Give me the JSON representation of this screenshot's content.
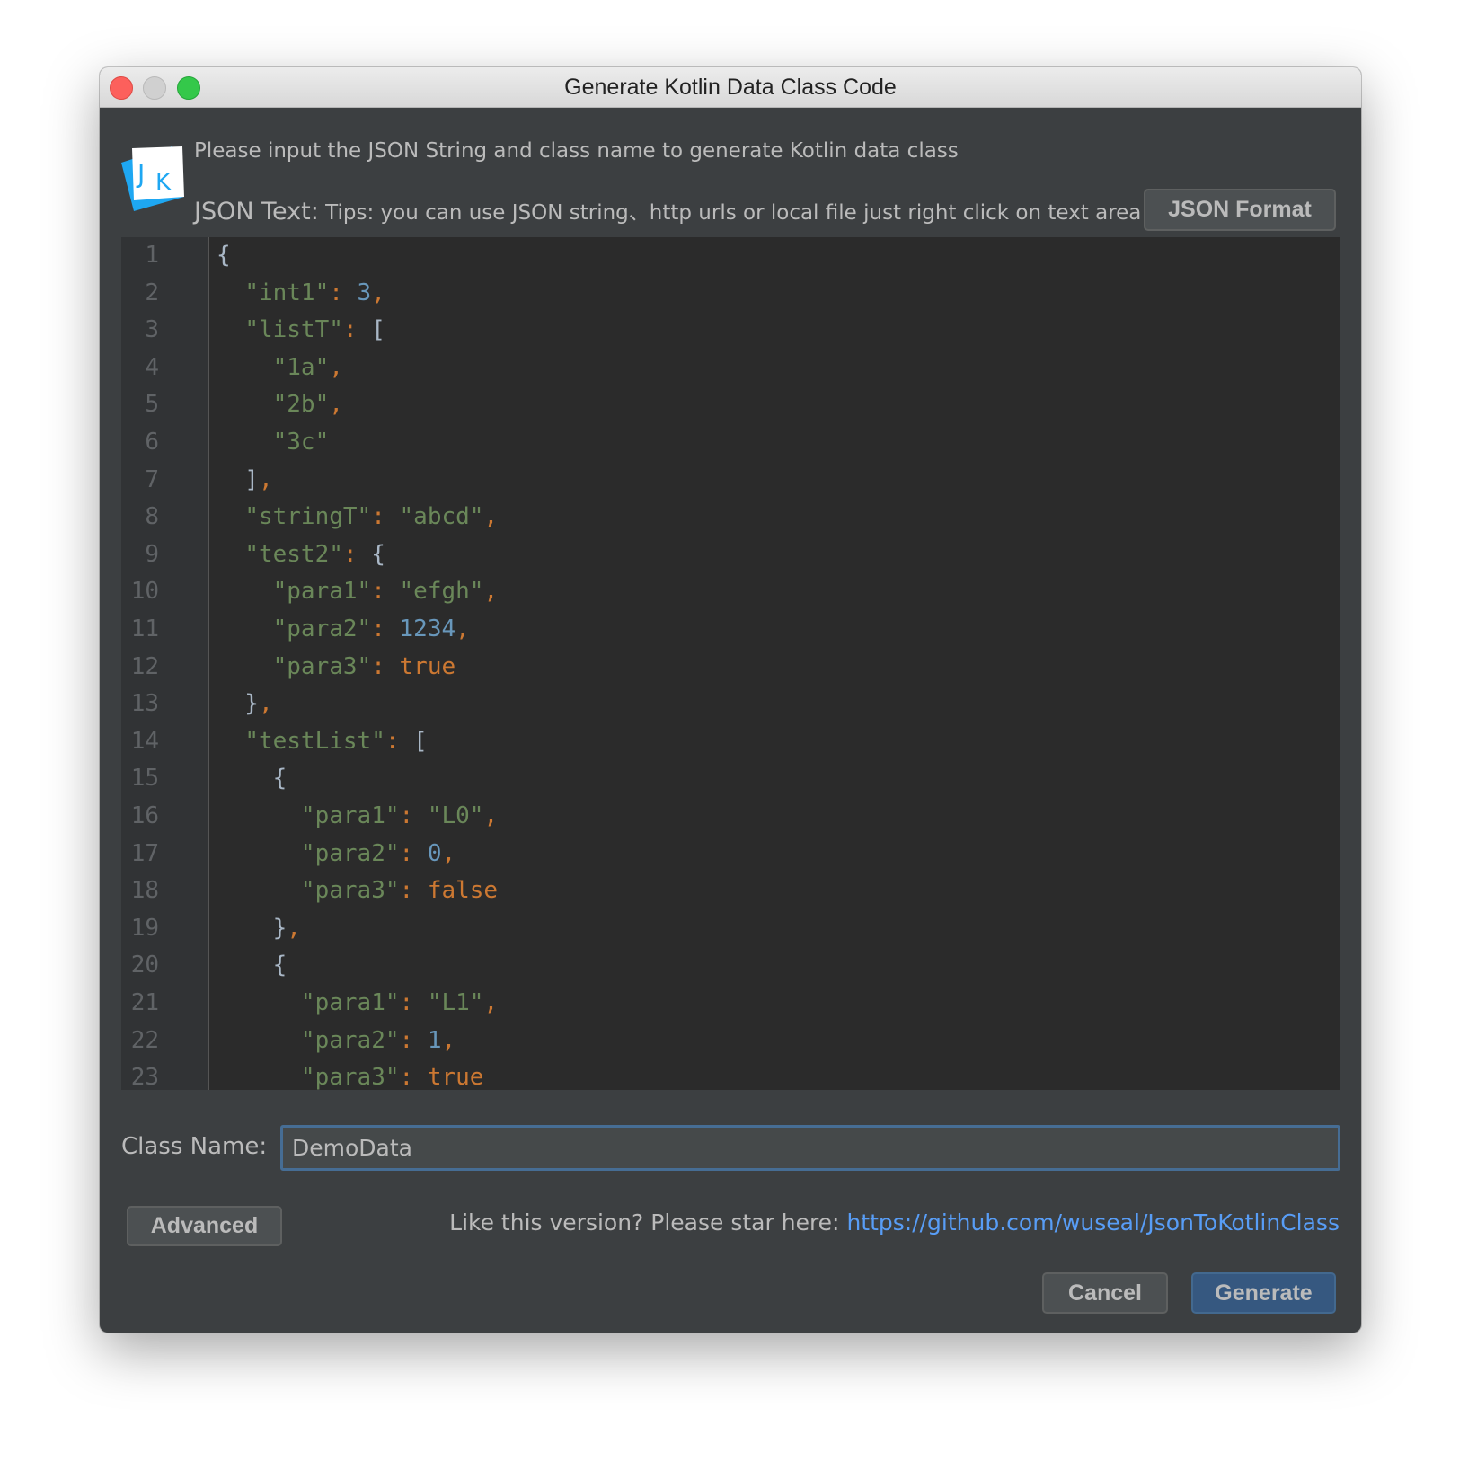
{
  "window": {
    "title": "Generate Kotlin Data Class Code"
  },
  "header": {
    "logo_text": "JK",
    "description": "Please input the JSON String and class name to generate Kotlin data class",
    "json_text_label": "JSON Text:",
    "tips": "Tips: you can use JSON string、http urls or local file just right click on text area",
    "format_button": "JSON Format"
  },
  "colors": {
    "background": "#3c3f41",
    "editor": "#2b2b2b",
    "string": "#6a8759",
    "number": "#6897bb",
    "keyword": "#cc7832",
    "punct": "#a9b7c6",
    "link": "#589df6",
    "primary_button": "#365880"
  },
  "editor": {
    "lines": [
      [
        [
          "p",
          "{"
        ]
      ],
      [
        [
          "p",
          "  "
        ],
        [
          "s",
          "\"int1\""
        ],
        [
          "c",
          ": "
        ],
        [
          "n",
          "3"
        ],
        [
          "c",
          ","
        ]
      ],
      [
        [
          "p",
          "  "
        ],
        [
          "s",
          "\"listT\""
        ],
        [
          "c",
          ": "
        ],
        [
          "p",
          "["
        ]
      ],
      [
        [
          "p",
          "    "
        ],
        [
          "s",
          "\"1a\""
        ],
        [
          "c",
          ","
        ]
      ],
      [
        [
          "p",
          "    "
        ],
        [
          "s",
          "\"2b\""
        ],
        [
          "c",
          ","
        ]
      ],
      [
        [
          "p",
          "    "
        ],
        [
          "s",
          "\"3c\""
        ]
      ],
      [
        [
          "p",
          "  ]"
        ],
        [
          "c",
          ","
        ]
      ],
      [
        [
          "p",
          "  "
        ],
        [
          "s",
          "\"stringT\""
        ],
        [
          "c",
          ": "
        ],
        [
          "s",
          "\"abcd\""
        ],
        [
          "c",
          ","
        ]
      ],
      [
        [
          "p",
          "  "
        ],
        [
          "s",
          "\"test2\""
        ],
        [
          "c",
          ": "
        ],
        [
          "p",
          "{"
        ]
      ],
      [
        [
          "p",
          "    "
        ],
        [
          "s",
          "\"para1\""
        ],
        [
          "c",
          ": "
        ],
        [
          "s",
          "\"efgh\""
        ],
        [
          "c",
          ","
        ]
      ],
      [
        [
          "p",
          "    "
        ],
        [
          "s",
          "\"para2\""
        ],
        [
          "c",
          ": "
        ],
        [
          "n",
          "1234"
        ],
        [
          "c",
          ","
        ]
      ],
      [
        [
          "p",
          "    "
        ],
        [
          "s",
          "\"para3\""
        ],
        [
          "c",
          ": "
        ],
        [
          "k",
          "true"
        ]
      ],
      [
        [
          "p",
          "  }"
        ],
        [
          "c",
          ","
        ]
      ],
      [
        [
          "p",
          "  "
        ],
        [
          "s",
          "\"testList\""
        ],
        [
          "c",
          ": "
        ],
        [
          "p",
          "["
        ]
      ],
      [
        [
          "p",
          "    {"
        ]
      ],
      [
        [
          "p",
          "      "
        ],
        [
          "s",
          "\"para1\""
        ],
        [
          "c",
          ": "
        ],
        [
          "s",
          "\"L0\""
        ],
        [
          "c",
          ","
        ]
      ],
      [
        [
          "p",
          "      "
        ],
        [
          "s",
          "\"para2\""
        ],
        [
          "c",
          ": "
        ],
        [
          "n",
          "0"
        ],
        [
          "c",
          ","
        ]
      ],
      [
        [
          "p",
          "      "
        ],
        [
          "s",
          "\"para3\""
        ],
        [
          "c",
          ": "
        ],
        [
          "k",
          "false"
        ]
      ],
      [
        [
          "p",
          "    }"
        ],
        [
          "c",
          ","
        ]
      ],
      [
        [
          "p",
          "    {"
        ]
      ],
      [
        [
          "p",
          "      "
        ],
        [
          "s",
          "\"para1\""
        ],
        [
          "c",
          ": "
        ],
        [
          "s",
          "\"L1\""
        ],
        [
          "c",
          ","
        ]
      ],
      [
        [
          "p",
          "      "
        ],
        [
          "s",
          "\"para2\""
        ],
        [
          "c",
          ": "
        ],
        [
          "n",
          "1"
        ],
        [
          "c",
          ","
        ]
      ],
      [
        [
          "p",
          "      "
        ],
        [
          "s",
          "\"para3\""
        ],
        [
          "c",
          ": "
        ],
        [
          "k",
          "true"
        ]
      ]
    ]
  },
  "class_name": {
    "label": "Class Name:",
    "value": "DemoData"
  },
  "footer": {
    "advanced_button": "Advanced",
    "star_text": "Like this version? Please star here: ",
    "link": "https://github.com/wuseal/JsonToKotlinClass",
    "cancel_button": "Cancel",
    "generate_button": "Generate"
  }
}
